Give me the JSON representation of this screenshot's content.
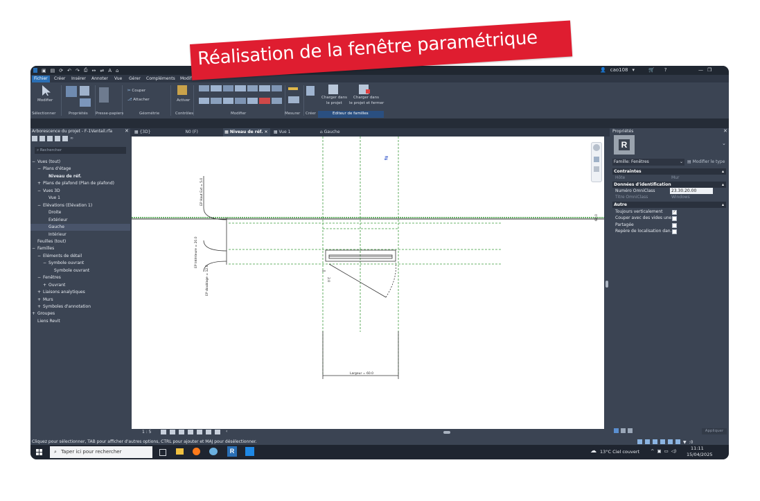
{
  "banner": {
    "text": "Réalisation de la fenêtre paramétrique"
  },
  "titlebar": {
    "user": "cao108"
  },
  "menu": {
    "items": [
      "Fichier",
      "Créer",
      "Insérer",
      "Annoter",
      "Vue",
      "Gérer",
      "Compléments",
      "Modif"
    ]
  },
  "ribbon": {
    "modifier": "Modifier",
    "couper": "Couper",
    "attacher": "Attacher",
    "activer": "Activer",
    "charger1": "Charger dans",
    "charger1b": "le projet",
    "charger2": "Charger dans",
    "charger2b": "le projet et fermer",
    "panels": [
      "Sélectionner",
      "Propriétés",
      "Presse-papiers",
      "Géométrie",
      "Contrôles",
      "Modifier",
      "Mesurer",
      "Créer",
      "Editeur de familles"
    ]
  },
  "browser": {
    "title": "Arborescence du projet - F-1Vantail.rfa",
    "search_placeholder": "Rechercher",
    "items": [
      {
        "label": "Vues (tout)",
        "prefix": "−",
        "indent": 0
      },
      {
        "label": "Plans d'étage",
        "prefix": "−",
        "indent": 1
      },
      {
        "label": "Niveau de réf.",
        "prefix": "",
        "indent": 2,
        "bold": true
      },
      {
        "label": "Plans de plafond (Plan de plafond)",
        "prefix": "+",
        "indent": 1
      },
      {
        "label": "Vues 3D",
        "prefix": "−",
        "indent": 1
      },
      {
        "label": "Vue 1",
        "prefix": "",
        "indent": 2
      },
      {
        "label": "Elévations (Elévation 1)",
        "prefix": "−",
        "indent": 1
      },
      {
        "label": "Droite",
        "prefix": "",
        "indent": 2
      },
      {
        "label": "Extérieur",
        "prefix": "",
        "indent": 2
      },
      {
        "label": "Gauche",
        "prefix": "",
        "indent": 2,
        "selected": true
      },
      {
        "label": "Intérieur",
        "prefix": "",
        "indent": 2
      },
      {
        "label": "Feuilles (tout)",
        "prefix": "",
        "indent": 0
      },
      {
        "label": "Familles",
        "prefix": "−",
        "indent": 0
      },
      {
        "label": "Eléments de détail",
        "prefix": "−",
        "indent": 1
      },
      {
        "label": "Symbole ouvrant",
        "prefix": "−",
        "indent": 2
      },
      {
        "label": "Symbole ouvrant",
        "prefix": "",
        "indent": 3
      },
      {
        "label": "Fenêtres",
        "prefix": "−",
        "indent": 1
      },
      {
        "label": "Ouvrant",
        "prefix": "+",
        "indent": 2
      },
      {
        "label": "Liaisons analytiques",
        "prefix": "+",
        "indent": 1
      },
      {
        "label": "Murs",
        "prefix": "+",
        "indent": 1
      },
      {
        "label": "Symboles d'annotation",
        "prefix": "+",
        "indent": 1
      },
      {
        "label": "Groupes",
        "prefix": "+",
        "indent": 0
      },
      {
        "label": "Liens Revit",
        "prefix": "",
        "indent": 0
      }
    ]
  },
  "viewtabs": {
    "items": [
      {
        "label": "{3D}",
        "active": false
      },
      {
        "label": "N0 (F)",
        "active": false
      },
      {
        "label": "Niveau de réf.",
        "active": true
      },
      {
        "label": "Vue 1",
        "active": false
      },
      {
        "label": "Gauche",
        "active": false
      }
    ]
  },
  "drawing": {
    "dim1": "EP Haut Ext = 5.0",
    "dim2": "EP Intérieure = 20.0",
    "dim3": "EP doublage = 12.0",
    "dim4": "Largeur = 60.0",
    "dim5": "60.0",
    "dim6": "2.0"
  },
  "viewbar": {
    "scale": "1 : 5"
  },
  "properties": {
    "title": "Propriétés",
    "family": "Famille: Fenêtres",
    "edit_type": "Modifier le type",
    "sections": {
      "contraintes": "Contraintes",
      "donnees": "Données d'identification",
      "autre": "Autre"
    },
    "host": {
      "k": "Hôte",
      "v": "Mur"
    },
    "omniclass_num": {
      "k": "Numéro OmniClass",
      "v": "23.30.20.00"
    },
    "omniclass_title": {
      "k": "Titre OmniClass",
      "v": "Windows"
    },
    "checks": [
      {
        "label": "Toujours verticalement",
        "checked": true
      },
      {
        "label": "Couper avec des vides une...",
        "checked": false
      },
      {
        "label": "Partagée",
        "checked": false
      },
      {
        "label": "Repère de localisation dan...",
        "checked": false
      }
    ],
    "apply": "Appliquer"
  },
  "status": {
    "text": "Cliquez pour sélectionner, TAB pour afficher d'autres options, CTRL pour ajouter et MAJ pour désélectionner.",
    "zero": ":0"
  },
  "taskbar": {
    "search": "Taper ici pour rechercher",
    "weather": "13°C  Ciel couvert",
    "time": "11:11",
    "date": "15/04/2025"
  }
}
